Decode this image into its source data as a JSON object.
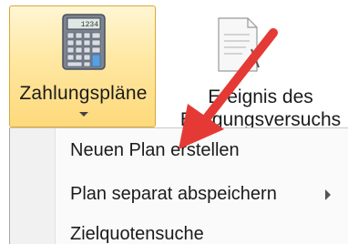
{
  "ribbon": {
    "active_button": {
      "label": "Zahlungspläne",
      "icon": "calculator-icon"
    },
    "second_button": {
      "label_line1": "Ereignis des",
      "label_line2": "Einigungsversuchs",
      "icon": "document-icon"
    }
  },
  "menu": {
    "items": [
      {
        "label": "Neuen Plan erstellen"
      },
      {
        "label": "Plan separat abspeichern",
        "has_submenu": true
      },
      {
        "label": "Zielquotensuche"
      }
    ]
  },
  "annotation": {
    "arrow_color": "#e53935"
  }
}
